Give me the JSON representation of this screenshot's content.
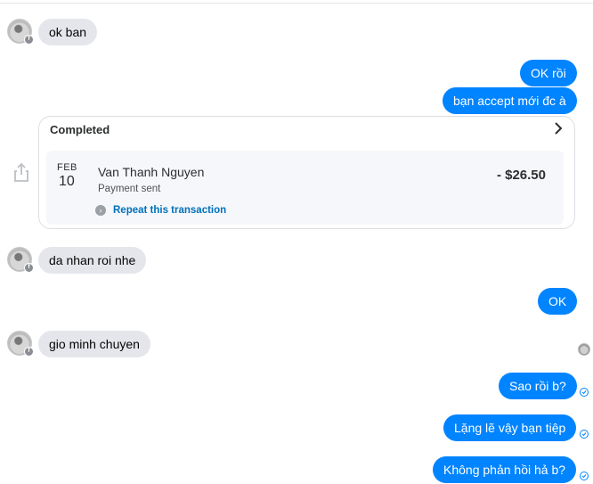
{
  "messages": {
    "m1": "ok ban",
    "m2": "OK rồi",
    "m3": "bạn accept mới đc à",
    "m4": "da nhan roi nhe",
    "m5": "OK",
    "m6": "gio minh chuyen",
    "m7": "Sao rồi b?",
    "m8": "Lặng lẽ vậy bạn tiệp",
    "m9": "Không phản hồi hả b?"
  },
  "payment_card": {
    "status": "Completed",
    "month": "FEB",
    "day": "10",
    "name": "Van Thanh Nguyen",
    "subtitle": "Payment sent",
    "amount": "- $26.50",
    "repeat_label": "Repeat this transaction"
  },
  "colors": {
    "outgoing_bubble": "#0084ff",
    "incoming_bubble": "#e4e6eb",
    "link": "#0070ba"
  },
  "icons": [
    "share-icon",
    "chevron-right-icon",
    "repeat-icon",
    "seen-check-icon",
    "messenger-badge-icon"
  ]
}
